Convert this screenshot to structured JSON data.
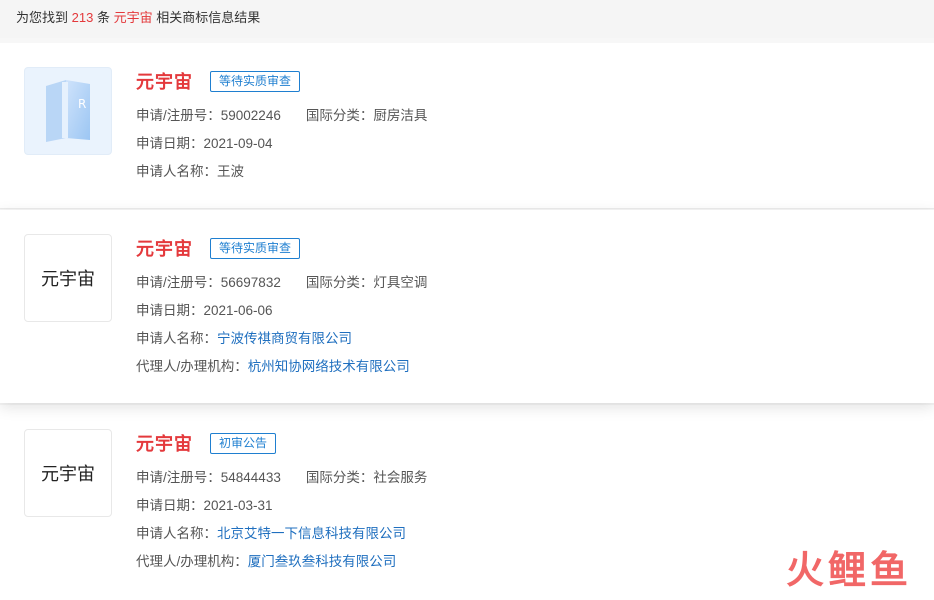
{
  "summary": {
    "prefix": "为您找到",
    "count": "213",
    "mid": "条",
    "keyword": "元宇宙",
    "suffix": "相关商标信息结果"
  },
  "labels": {
    "reg_no": "申请/注册号：",
    "intl_class": "国际分类：",
    "apply_date": "申请日期：",
    "applicant": "申请人名称：",
    "agent": "代理人/办理机构："
  },
  "results": [
    {
      "name": "元宇宙",
      "status": "等待实质审查",
      "logo_text": "",
      "reg_no": "59002246",
      "intl_class": "厨房洁具",
      "apply_date": "2021-09-04",
      "applicant": "王波"
    },
    {
      "name": "元宇宙",
      "status": "等待实质审查",
      "logo_text": "元宇宙",
      "reg_no": "56697832",
      "intl_class": "灯具空调",
      "apply_date": "2021-06-06",
      "applicant": "宁波传祺商贸有限公司",
      "agent": "杭州知协网络技术有限公司"
    },
    {
      "name": "元宇宙",
      "status": "初审公告",
      "logo_text": "元宇宙",
      "reg_no": "54844433",
      "intl_class": "社会服务",
      "apply_date": "2021-03-31",
      "applicant": "北京艾特一下信息科技有限公司",
      "agent": "厦门叁玖叁科技有限公司"
    }
  ],
  "watermark": "火鲤鱼",
  "colors": {
    "accent_red": "#e4393c",
    "link_blue": "#1f6fbf",
    "status_blue": "#1f7fd0"
  }
}
